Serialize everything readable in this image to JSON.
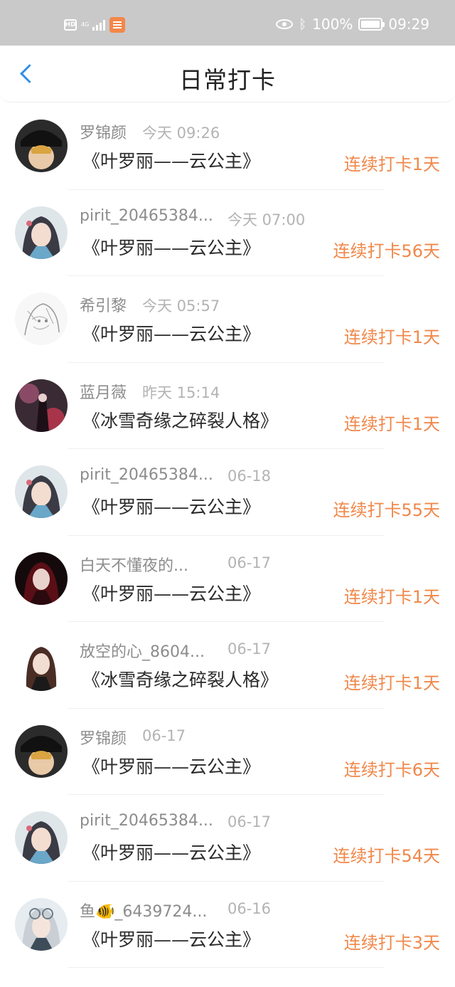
{
  "status_bar": {
    "hd": "HD",
    "network": "4G",
    "battery": "100%",
    "time": "09:29",
    "icons": [
      "hd-icon",
      "signal-icon",
      "app-notification-icon",
      "eye-comfort-icon",
      "bluetooth-icon",
      "battery-icon"
    ]
  },
  "header": {
    "title": "日常打卡",
    "back_icon": "chevron-left-icon",
    "accent": "#2f8fe8"
  },
  "colors": {
    "streak": "#f0884a",
    "name": "#8c8c8c",
    "time": "#b3b3b3"
  },
  "entries": [
    {
      "name": "罗锦颜",
      "time": "今天 09:26",
      "book": "《叶罗丽——云公主》",
      "streak": "连续打卡1天"
    },
    {
      "name": "pirit_20465384...",
      "time": "今天 07:00",
      "book": "《叶罗丽——云公主》",
      "streak": "连续打卡56天"
    },
    {
      "name": "希引黎",
      "time": "今天 05:57",
      "book": "《叶罗丽——云公主》",
      "streak": "连续打卡1天"
    },
    {
      "name": "蓝月薇",
      "time": "昨天 15:14",
      "book": "《冰雪奇缘之碎裂人格》",
      "streak": "连续打卡1天"
    },
    {
      "name": "pirit_20465384...",
      "time": "06-18",
      "book": "《叶罗丽——云公主》",
      "streak": "连续打卡55天"
    },
    {
      "name": "白天不懂夜的...",
      "time": "06-17",
      "book": "《叶罗丽——云公主》",
      "streak": "连续打卡1天"
    },
    {
      "name": "放空的心_8604...",
      "time": "06-17",
      "book": "《冰雪奇缘之碎裂人格》",
      "streak": "连续打卡1天"
    },
    {
      "name": "罗锦颜",
      "time": "06-17",
      "book": "《叶罗丽——云公主》",
      "streak": "连续打卡6天"
    },
    {
      "name": "pirit_20465384...",
      "time": "06-17",
      "book": "《叶罗丽——云公主》",
      "streak": "连续打卡54天"
    },
    {
      "name": "鱼🐠_6439724...",
      "time": "06-16",
      "book": "《叶罗丽——云公主》",
      "streak": "连续打卡3天"
    }
  ]
}
